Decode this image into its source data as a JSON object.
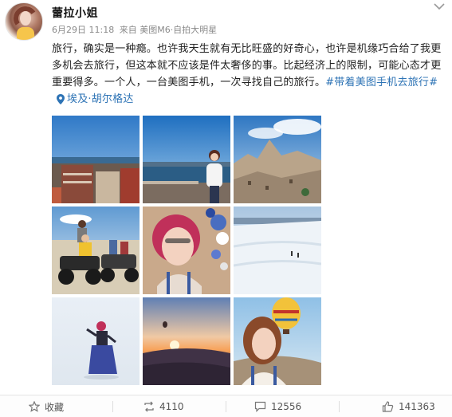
{
  "user": {
    "name": "蕾拉小姐"
  },
  "meta": {
    "timestamp": "6月29日 11:18",
    "source": "来自 美图M6·自拍大明星"
  },
  "post": {
    "text": "旅行，确实是一种瘾。也许我天生就有无比旺盛的好奇心，也许是机缘巧合给了我更多机会去旅行，但这本就不应该是件太奢侈的事。比起经济上的限制，可能心态才更重要得多。一个人，一台美图手机，一次寻找自己的旅行。",
    "hashtag": "#带着美图手机去旅行#",
    "location": "埃及·胡尔格达"
  },
  "footer": {
    "favorite_label": "收藏",
    "repost_count": "4110",
    "comment_count": "12556",
    "like_count": "141363"
  },
  "icons": {
    "menu": "chevron-down-icon",
    "location": "location-pin-icon",
    "favorite": "star-icon",
    "repost": "repost-icon",
    "comment": "comment-icon",
    "like": "thumbs-up-icon"
  },
  "colors": {
    "link": "#2d73b5",
    "text": "#222222",
    "meta": "#8a8a8a"
  }
}
